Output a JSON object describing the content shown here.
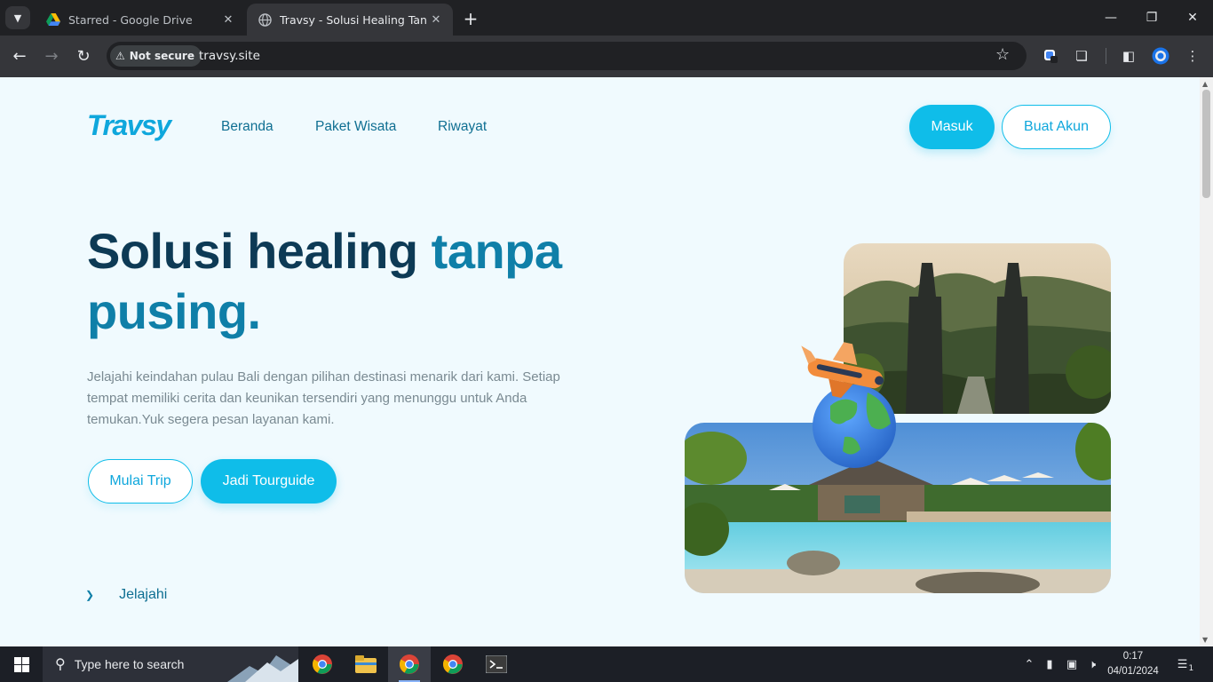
{
  "browser": {
    "tabs": [
      {
        "title": "Starred - Google Drive",
        "active": false,
        "favicon": "google-drive-icon"
      },
      {
        "title": "Travsy - Solusi Healing Tanpa Pu",
        "active": true,
        "favicon": "globe-icon"
      }
    ],
    "security_label": "Not secure",
    "url": "travsy.site"
  },
  "site": {
    "logo": "Travsy",
    "nav": [
      "Beranda",
      "Paket Wisata",
      "Riwayat"
    ],
    "login_label": "Masuk",
    "signup_label": "Buat Akun",
    "hero": {
      "title_part1": "Solusi healing ",
      "title_part2": "tanpa pusing.",
      "description": "Jelajahi keindahan pulau Bali dengan pilihan destinasi menarik dari kami. Setiap tempat memiliki cerita dan keunikan tersendiri yang menunggu untuk Anda temukan.Yuk segera pesan layanan kami.",
      "primary_cta": "Mulai Trip",
      "secondary_cta": "Jadi Tourguide",
      "explore_label": "Jelajahi"
    },
    "colors": {
      "accent": "#0fbde9",
      "heading": "#0d3a55",
      "heading_accent": "#0f7fa8",
      "background": "#f0fafe"
    }
  },
  "taskbar": {
    "search_placeholder": "Type here to search",
    "time": "0:17",
    "date": "04/01/2024",
    "notification_count": "1"
  }
}
